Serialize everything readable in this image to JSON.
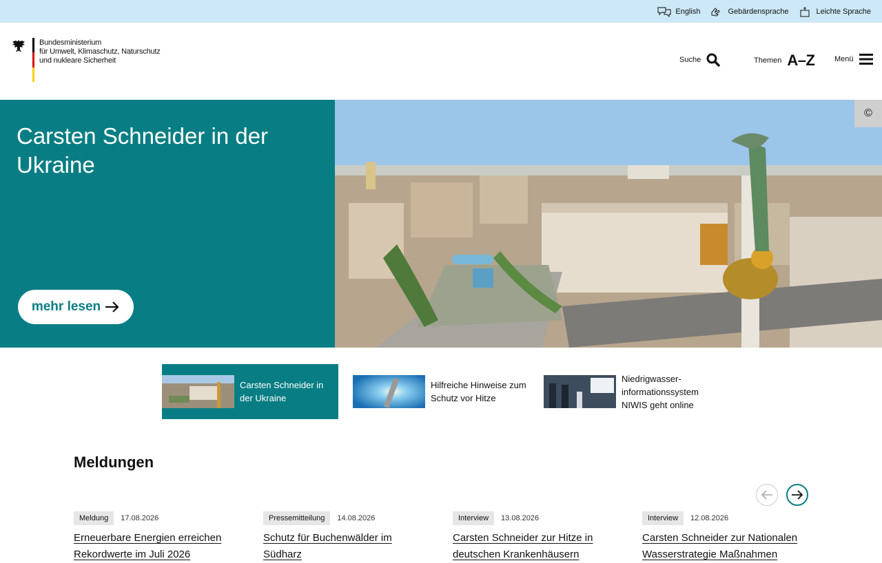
{
  "topbar": {
    "links": [
      {
        "label": "English",
        "icon": "speech-bubbles-icon"
      },
      {
        "label": "Gebärdensprache",
        "icon": "sign-language-icon"
      },
      {
        "label": "Leichte Sprache",
        "icon": "easy-language-icon"
      }
    ]
  },
  "header": {
    "logo_lines": [
      "Bundesministerium",
      "für Umwelt, Klimaschutz, Naturschutz",
      "und nukleare Sicherheit"
    ],
    "search_label": "Suche",
    "themen_label": "Themen",
    "az_label": "A–Z",
    "menu_label": "Menü"
  },
  "hero": {
    "title": "Carsten Schneider in der Ukraine",
    "button_label": "mehr lesen",
    "copyright_symbol": "©"
  },
  "teasers": [
    {
      "text": "Carsten Schneider in der Ukraine",
      "active": true
    },
    {
      "text": "Hilfreiche Hinweise zum Schutz vor Hitze",
      "active": false
    },
    {
      "text": "Niedrigwasser-informationssystem NIWIS geht online",
      "active": false
    }
  ],
  "news": {
    "section_title": "Meldungen",
    "items": [
      {
        "tag": "Meldung",
        "date": "17.08.2026",
        "title": "Erneuerbare Energien erreichen Rekordwerte im Juli 2026"
      },
      {
        "tag": "Pressemitteilung",
        "date": "14.08.2026",
        "title": "Schutz für Buchenwälder im Südharz"
      },
      {
        "tag": "Interview",
        "date": "13.08.2026",
        "title": "Carsten Schneider zur Hitze in deutschen Krankenhäusern"
      },
      {
        "tag": "Interview",
        "date": "12.08.2026",
        "title": "Carsten Schneider zur Nationalen Wasserstrategie Maßnahmen"
      }
    ]
  },
  "colors": {
    "accent": "#087e84",
    "topbar": "#cde8f6"
  }
}
